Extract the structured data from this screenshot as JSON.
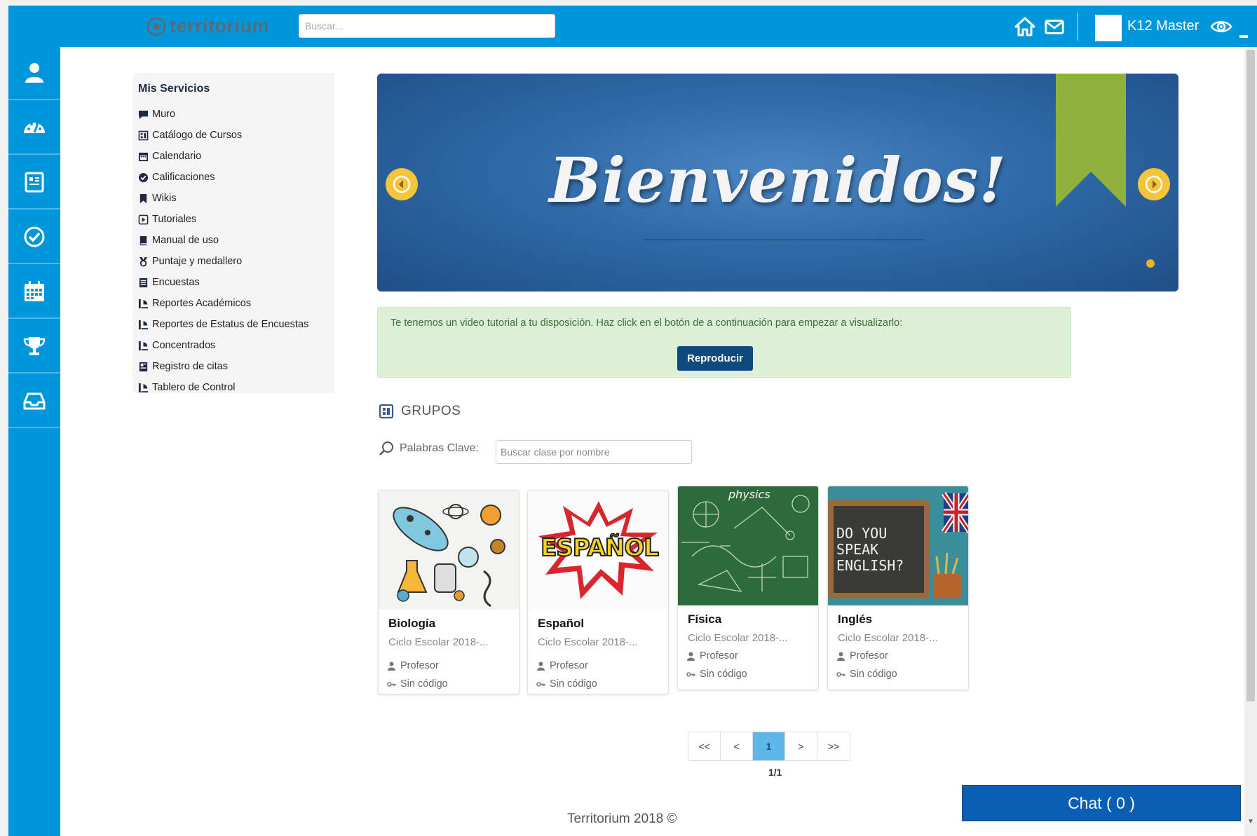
{
  "app": {
    "logo_text": "territorium",
    "brand_color": "#0096db"
  },
  "topbar": {
    "search_placeholder": "Buscar...",
    "user_name": "K12 Master",
    "icons": [
      "home-icon",
      "mail-icon",
      "eye-icon"
    ]
  },
  "rail": {
    "icons": [
      "user-icon",
      "dashboard-icon",
      "catalog-icon",
      "check-circle-icon",
      "calendar-icon",
      "trophy-icon",
      "inbox-icon"
    ]
  },
  "services": {
    "title": "Mis Servicios",
    "items": [
      {
        "label": "Muro",
        "icon": "comment-icon"
      },
      {
        "label": "Catálogo de Cursos",
        "icon": "catalog-icon"
      },
      {
        "label": "Calendario",
        "icon": "calendar-icon"
      },
      {
        "label": "Calificaciones",
        "icon": "check-circle-icon"
      },
      {
        "label": "Wikis",
        "icon": "bookmark-icon"
      },
      {
        "label": "Tutoriales",
        "icon": "play-square-icon"
      },
      {
        "label": "Manual de uso",
        "icon": "book-icon"
      },
      {
        "label": "Puntaje y medallero",
        "icon": "medal-icon"
      },
      {
        "label": "Encuestas",
        "icon": "list-icon"
      },
      {
        "label": "Reportes Académicos",
        "icon": "report-icon"
      },
      {
        "label": "Reportes de Estatus de Encuestas",
        "icon": "report-icon"
      },
      {
        "label": "Concentrados",
        "icon": "report-icon"
      },
      {
        "label": "Registro de citas",
        "icon": "book-icon"
      },
      {
        "label": "Tablero de Control",
        "icon": "report-icon"
      }
    ]
  },
  "banner": {
    "title": "Bienvenidos!"
  },
  "notice": {
    "text": "Te tenemos un video tutorial a tu disposición. Haz click en el botón de a continuación para empezar a visualizarlo:",
    "button_label": "Reproducir"
  },
  "groups": {
    "heading": "GRUPOS",
    "keyword_label": "Palabras Clave:",
    "keyword_placeholder": "Buscar clase por nombre",
    "cards": [
      {
        "title": "Biología",
        "cycle": "Ciclo Escolar 2018-...",
        "teacher": "Profesor",
        "code": "Sin código",
        "image": "biology-illustration"
      },
      {
        "title": "Español",
        "cycle": "Ciclo Escolar 2018-...",
        "teacher": "Profesor",
        "code": "Sin código",
        "image": "espanol-comic-text",
        "image_text": "ESPAÑOL"
      },
      {
        "title": "Física",
        "cycle": "Ciclo Escolar 2018-...",
        "teacher": "Profesor",
        "code": "Sin código",
        "image": "physics-chalkboard",
        "image_text": "physics"
      },
      {
        "title": "Inglés",
        "cycle": "Ciclo Escolar 2018-...",
        "teacher": "Profesor",
        "code": "Sin código",
        "image": "english-chalkboard",
        "image_text": "DO YOU SPEAK ENGLISH?"
      }
    ]
  },
  "pagination": {
    "first": "<<",
    "prev": "<",
    "current": "1",
    "next": ">",
    "last": ">>",
    "info": "1/1"
  },
  "footer": {
    "text": "Territorium 2018 ©"
  },
  "chat": {
    "label": "Chat ( 0 )"
  }
}
